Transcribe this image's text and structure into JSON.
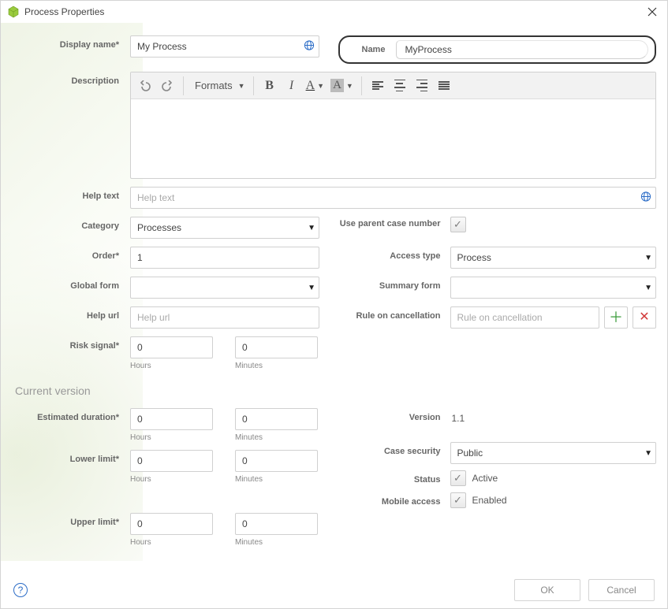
{
  "titlebar": {
    "title": "Process Properties",
    "close_tip": "Close"
  },
  "labels": {
    "display_name": "Display name*",
    "name": "Name",
    "description": "Description",
    "formats": "Formats",
    "help_text": "Help text",
    "category": "Category",
    "order": "Order*",
    "global_form": "Global form",
    "help_url": "Help url",
    "risk_signal": "Risk signal*",
    "hours": "Hours",
    "minutes": "Minutes",
    "use_parent_case_number": "Use parent case number",
    "access_type": "Access type",
    "summary_form": "Summary form",
    "rule_on_cancellation": "Rule on cancellation",
    "current_version": "Current version",
    "estimated_duration": "Estimated duration*",
    "lower_limit": "Lower limit*",
    "upper_limit": "Upper limit*",
    "version": "Version",
    "case_security": "Case security",
    "status": "Status",
    "mobile_access": "Mobile access",
    "active": "Active",
    "enabled": "Enabled"
  },
  "values": {
    "display_name": "My Process",
    "name": "MyProcess",
    "help_text_placeholder": "Help text",
    "category": "Processes",
    "order": "1",
    "global_form": "",
    "help_url_placeholder": "Help url",
    "risk_hours": "0",
    "risk_minutes": "0",
    "use_parent_case_number_checked": true,
    "access_type": "Process",
    "summary_form": "",
    "rule_on_cancellation_placeholder": "Rule on cancellation",
    "est_hours": "0",
    "est_minutes": "0",
    "low_hours": "0",
    "low_minutes": "0",
    "up_hours": "0",
    "up_minutes": "0",
    "version": "1.1",
    "case_security": "Public",
    "status_checked": true,
    "mobile_access_checked": true
  },
  "footer": {
    "ok": "OK",
    "cancel": "Cancel"
  },
  "icons": {
    "app": "cube-icon",
    "globe": "globe-icon",
    "plus": "plus-icon",
    "remove": "remove-icon",
    "help": "help-icon"
  }
}
